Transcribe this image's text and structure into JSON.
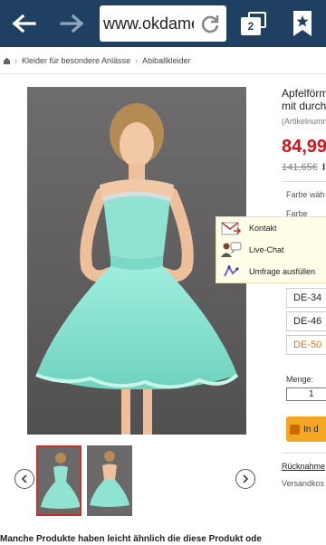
{
  "browser": {
    "url": "www.okdame",
    "tab_count": "2"
  },
  "breadcrumb": {
    "items": [
      "Kleider für besondere Anlässe",
      "Abiballkleider"
    ]
  },
  "product": {
    "title_line1": "Apfelförm",
    "title_line2": "mit durch",
    "article_no": "(Artikelnumm",
    "price": "84,99",
    "old_price": "141,65€",
    "old_price_tail": "I"
  },
  "options": {
    "farbe_waehlen": "Farbe wäh",
    "farbe": "Farbe",
    "sizes": [
      "DE-34",
      "DE-46",
      "DE-50"
    ],
    "selected_size": "DE-50",
    "menge_label": "Menge:",
    "quantity": "1",
    "cart_label": "In d"
  },
  "contact_overlay": {
    "items": [
      {
        "label": "Kontakt",
        "icon": "mail-icon"
      },
      {
        "label": "Live-Chat",
        "icon": "chat-icon"
      },
      {
        "label": "Umfrage ausfüllen",
        "icon": "survey-icon"
      }
    ]
  },
  "footer_links": {
    "return": "Rücknahme",
    "shipping": "Versandkos"
  },
  "colors": {
    "toolbar": "#1f4060",
    "price": "#d4111b",
    "selected_size": "#e9730c",
    "cart_button": "#f5a623",
    "dress": "#7fe0cc"
  },
  "bottom": {
    "text": "Manche Produkte haben leicht ähnlich die diese Produkt ode"
  }
}
